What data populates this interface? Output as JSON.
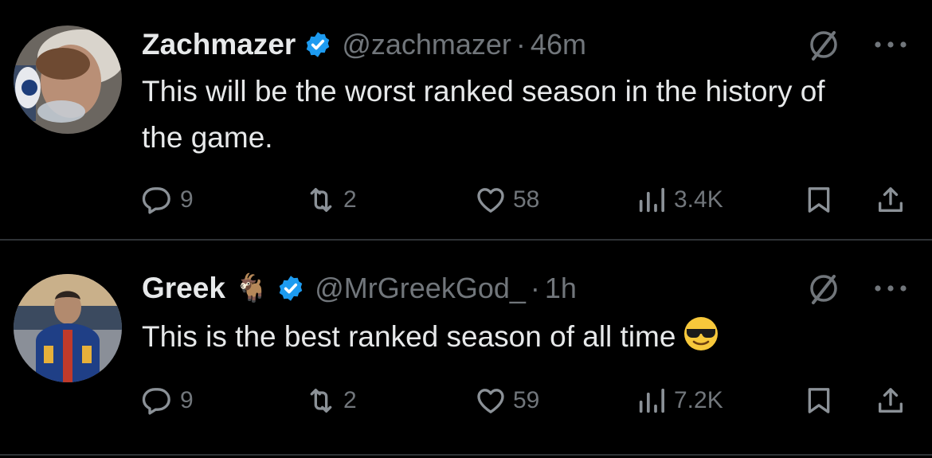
{
  "tweets": [
    {
      "name": "Zachmazer",
      "name_emoji": "",
      "handle": "@zachmazer",
      "separator": "·",
      "time": "46m",
      "text": "This will be the worst ranked season in the history of the game.",
      "reply_count": "9",
      "retweet_count": "2",
      "like_count": "58",
      "view_count": "3.4K"
    },
    {
      "name": "Greek",
      "name_emoji": "🐐",
      "handle": "@MrGreekGod_",
      "separator": "·",
      "time": "1h",
      "text": "This is the best ranked season of all time",
      "reply_count": "9",
      "retweet_count": "2",
      "like_count": "59",
      "view_count": "7.2K"
    }
  ],
  "colors": {
    "background": "#000000",
    "text": "#e7e9ea",
    "muted": "#71767b",
    "verified": "#1d9bf0",
    "divider": "#2f3336"
  },
  "icons": {
    "verified": "verified-badge-icon",
    "grok": "grok-slash-icon",
    "more": "more-dots-icon",
    "reply": "reply-bubble-icon",
    "retweet": "retweet-icon",
    "like": "heart-icon",
    "views": "views-bars-icon",
    "bookmark": "bookmark-icon",
    "share": "share-icon",
    "emoji": "sunglasses-emoji-icon"
  }
}
